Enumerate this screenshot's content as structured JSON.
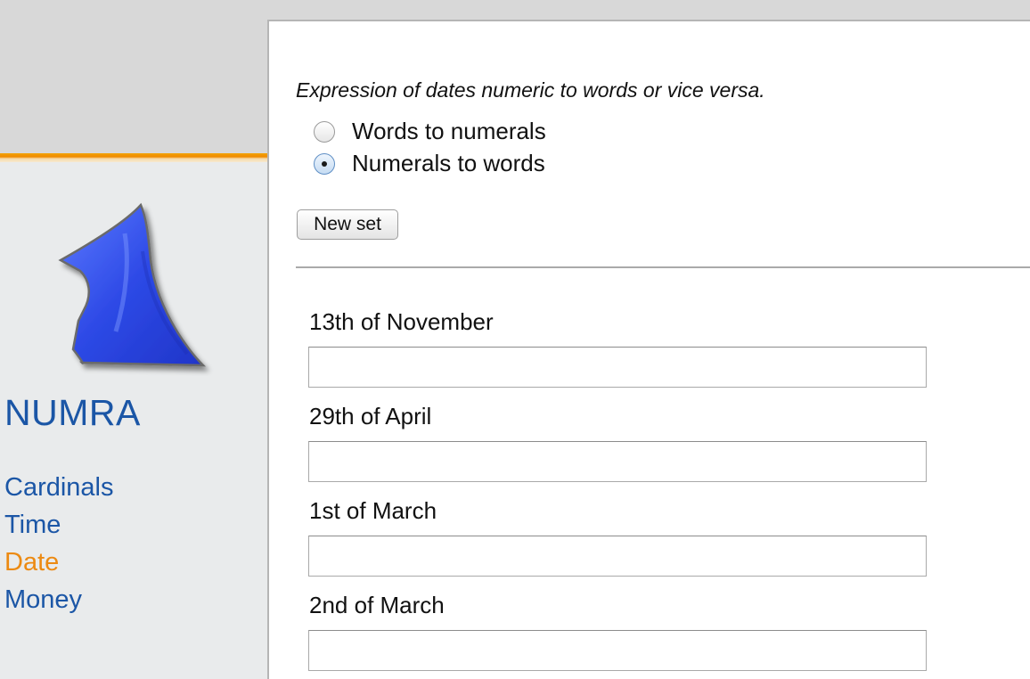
{
  "sidebar": {
    "brand": "NUMRA",
    "logo_icon": "numeral-one-logo-icon",
    "nav": [
      {
        "label": "Cardinals",
        "active": false
      },
      {
        "label": "Time",
        "active": false
      },
      {
        "label": "Date",
        "active": true
      },
      {
        "label": "Money",
        "active": false
      }
    ]
  },
  "main": {
    "instruction": "Expression of dates numeric to words or vice versa.",
    "options": [
      {
        "label": "Words to numerals",
        "selected": false
      },
      {
        "label": "Numerals to words",
        "selected": true
      }
    ],
    "new_set_label": "New set",
    "questions": [
      {
        "label": "13th of November",
        "value": ""
      },
      {
        "label": "29th of April",
        "value": ""
      },
      {
        "label": "1st of March",
        "value": ""
      },
      {
        "label": "2nd of March",
        "value": ""
      }
    ]
  },
  "colors": {
    "link": "#1b56a6",
    "active_link": "#ec8a12",
    "accent_line": "#f08a00",
    "logo_fill": "#2f4fe0"
  }
}
